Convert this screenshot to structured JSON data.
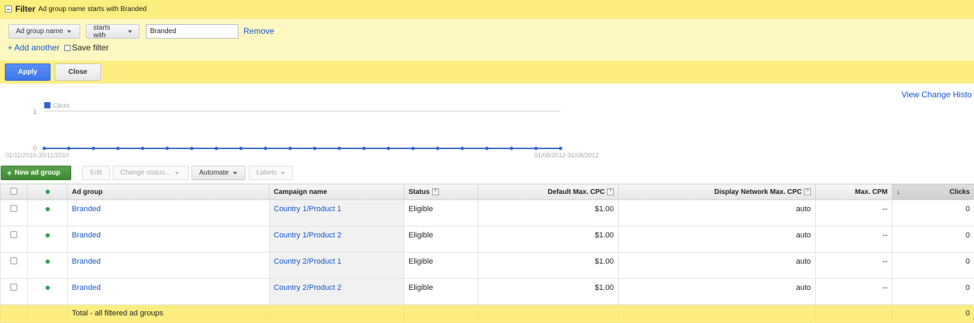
{
  "filter": {
    "title": "Filter",
    "description": "Ad group name starts with Branded",
    "field_label": "Ad group name",
    "operator_label": "starts with",
    "value": "Branded",
    "remove_label": "Remove",
    "add_another_label": "+ Add another",
    "save_filter_label": "Save filter",
    "apply_label": "Apply",
    "close_label": "Close"
  },
  "view_change_history_label": "View Change Histo",
  "chart_data": {
    "type": "line",
    "series": [
      {
        "name": "Clicks",
        "values": [
          0,
          0,
          0,
          0,
          0,
          0,
          0,
          0,
          0,
          0,
          0,
          0,
          0,
          0,
          0,
          0,
          0,
          0,
          0,
          0,
          0,
          0
        ]
      }
    ],
    "y_ticks": [
      "1",
      "0"
    ],
    "ylim": [
      0,
      1
    ],
    "x_start_label": "01/11/2010-30/11/2010",
    "x_end_label": "01/08/2012-31/08/2012",
    "grid": true,
    "legend_position": "top-left",
    "color": "#3366cc"
  },
  "toolbar": {
    "new_ad_group": "New ad group",
    "edit": "Edit",
    "change_status": "Change status...",
    "automate": "Automate",
    "labels": "Labels"
  },
  "table": {
    "headers": {
      "ad_group": "Ad group",
      "campaign": "Campaign name",
      "status": "Status",
      "default_cpc": "Default Max. CPC",
      "display_cpc": "Display Network Max. CPC",
      "max_cpm": "Max. CPM",
      "clicks": "Clicks"
    },
    "rows": [
      {
        "ad_group": "Branded",
        "campaign": "Country 1/Product 1",
        "status": "Eligible",
        "default_cpc": "$1.00",
        "display_cpc": "auto",
        "max_cpm": "--",
        "clicks": "0"
      },
      {
        "ad_group": "Branded",
        "campaign": "Country 1/Product 2",
        "status": "Eligible",
        "default_cpc": "$1.00",
        "display_cpc": "auto",
        "max_cpm": "--",
        "clicks": "0"
      },
      {
        "ad_group": "Branded",
        "campaign": "Country 2/Product 1",
        "status": "Eligible",
        "default_cpc": "$1.00",
        "display_cpc": "auto",
        "max_cpm": "--",
        "clicks": "0"
      },
      {
        "ad_group": "Branded",
        "campaign": "Country 2/Product 2",
        "status": "Eligible",
        "default_cpc": "$1.00",
        "display_cpc": "auto",
        "max_cpm": "--",
        "clicks": "0"
      }
    ],
    "total": {
      "label": "Total - all filtered ad groups",
      "clicks": "0"
    }
  },
  "colors": {
    "filter_yellow": "#fcee7f",
    "filter_light": "#fdf8c2",
    "link_blue": "#1155cc",
    "apply_blue": "#4d87f6",
    "new_green": "#4c9641",
    "status_dot": "#2d9e4a"
  }
}
